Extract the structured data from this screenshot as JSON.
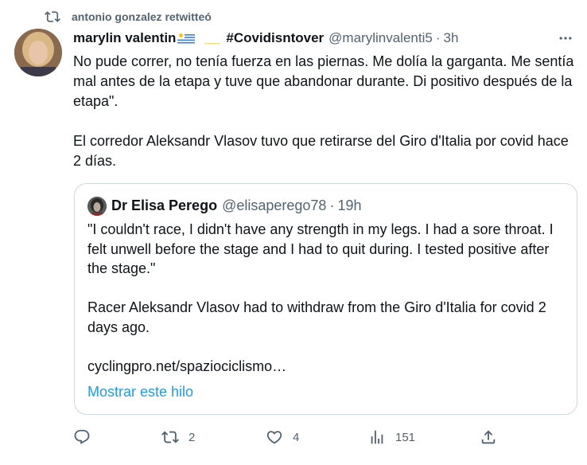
{
  "retweet": {
    "label": "antonio gonzalez retwitteó",
    "icon": "retweet-icon"
  },
  "tweet": {
    "author_name": "marylin valentin",
    "flag": "uruguay-flag",
    "underscore": "__",
    "hashtag": "#Covidisntover",
    "handle": "@marylinvalenti5",
    "separator": "·",
    "time": "3h",
    "text": "No pude correr, no tenía fuerza en las piernas. Me dolía la garganta. Me sentía mal antes de la etapa y tuve que abandonar durante. Di positivo después de la etapa\".\n\nEl corredor Aleksandr Vlasov tuvo que retirarse del Giro d'Italia por covid hace 2 días."
  },
  "quote": {
    "author_name": "Dr Elisa Perego",
    "handle": "@elisaperego78",
    "separator": "·",
    "time": "19h",
    "text": "\"I couldn't race, I didn't have any strength in my legs. I had a sore throat. I felt unwell before the stage and I had to quit during. I tested positive after the stage.\"\n\nRacer Aleksandr Vlasov had to withdraw from the Giro d'Italia for covid 2 days ago.\n\ncyclingpro.net/spaziociclismo…",
    "show_thread": "Mostrar este hilo"
  },
  "actions": {
    "reply": {
      "icon": "reply-icon",
      "count": ""
    },
    "retweet": {
      "icon": "retweet-icon",
      "count": "2"
    },
    "like": {
      "icon": "heart-icon",
      "count": "4"
    },
    "views": {
      "icon": "views-icon",
      "count": "151"
    },
    "share": {
      "icon": "share-icon",
      "count": ""
    }
  },
  "colors": {
    "text": "#0f1419",
    "muted": "#536471",
    "link": "#1d9bf0",
    "border": "#cfd9de"
  }
}
